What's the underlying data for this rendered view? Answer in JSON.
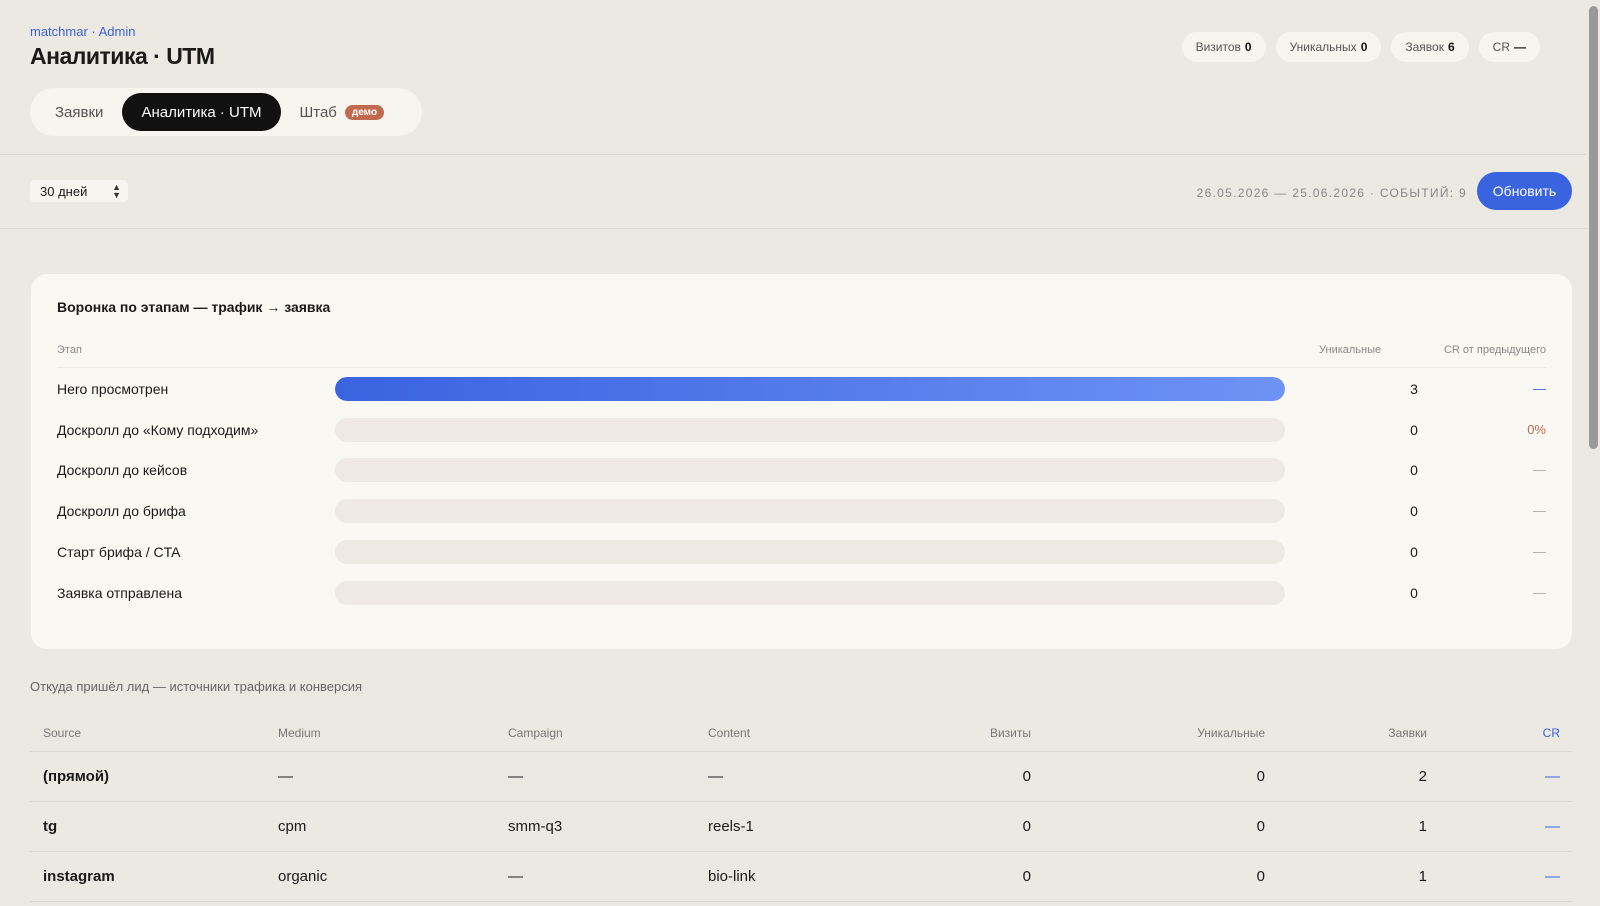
{
  "header": {
    "brand": "matchmar · Admin",
    "title": "Аналитика · UTM",
    "stats": [
      {
        "label": "Визитов",
        "value": "0"
      },
      {
        "label": "Уникальных",
        "value": "0"
      },
      {
        "label": "Заявок",
        "value": "6"
      },
      {
        "label": "CR",
        "value": "—"
      }
    ]
  },
  "tabs": [
    {
      "label": "Заявки"
    },
    {
      "label": "Аналитика · UTM"
    },
    {
      "label": "Штаб",
      "badge": "демо"
    }
  ],
  "toolbar": {
    "period": "30 дней",
    "range": "26.05.2026 — 25.06.2026 · СОБЫТИЙ: 9",
    "refresh_label": "Обновить"
  },
  "funnel": {
    "title": "Воронка по этапам — трафик → заявка",
    "columns": {
      "stage": "Этап",
      "unique": "Уникальные",
      "cr": "CR от предыдущего"
    },
    "rows": [
      {
        "label": "Hero просмотрен",
        "unique": "3",
        "cr": "—",
        "fill": 1.0
      },
      {
        "label": "Доскролл до «Кому подходим»",
        "unique": "0",
        "cr": "0%",
        "fill": 0
      },
      {
        "label": "Доскролл до кейсов",
        "unique": "0",
        "cr": "—",
        "fill": 0
      },
      {
        "label": "Доскролл до брифа",
        "unique": "0",
        "cr": "—",
        "fill": 0
      },
      {
        "label": "Старт брифа / CTA",
        "unique": "0",
        "cr": "—",
        "fill": 0
      },
      {
        "label": "Заявка отправлена",
        "unique": "0",
        "cr": "—",
        "fill": 0
      }
    ]
  },
  "sources": {
    "title": "Откуда пришёл лид — источники трафика и конверсия",
    "columns": {
      "source": "Source",
      "medium": "Medium",
      "campaign": "Campaign",
      "content": "Content",
      "visits": "Визиты",
      "unique": "Уникальные",
      "leads": "Заявки",
      "cr": "CR"
    },
    "rows": [
      {
        "source": "(прямой)",
        "medium": "—",
        "campaign": "—",
        "content": "—",
        "visits": "0",
        "unique": "0",
        "leads": "2",
        "cr": "—"
      },
      {
        "source": "tg",
        "medium": "cpm",
        "campaign": "smm-q3",
        "content": "reels-1",
        "visits": "0",
        "unique": "0",
        "leads": "1",
        "cr": "—"
      },
      {
        "source": "instagram",
        "medium": "organic",
        "campaign": "—",
        "content": "bio-link",
        "visits": "0",
        "unique": "0",
        "leads": "1",
        "cr": "—"
      }
    ]
  }
}
